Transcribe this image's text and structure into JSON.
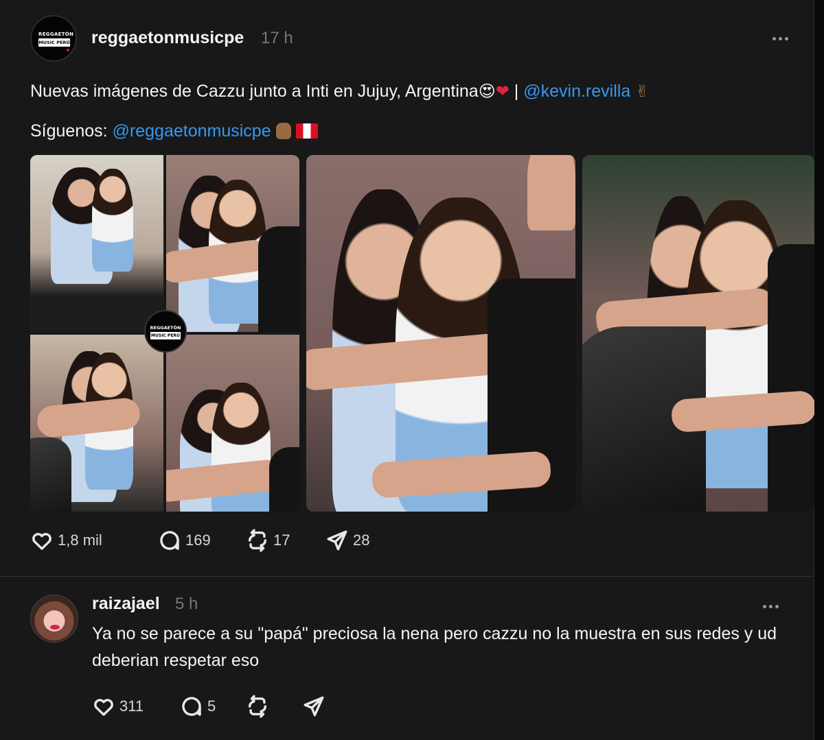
{
  "post": {
    "avatar_logo": {
      "line1": "REGGAETÓN",
      "line2": "MUSIC PERÚ"
    },
    "username": "reggaetonmusicpe",
    "time": "17 h",
    "caption": {
      "text": "Nuevas imágenes de Cazzu junto a Inti en Jujuy, Argentina",
      "emoji_face": "😍",
      "emoji_heart": "❤",
      "separator": " | ",
      "mention": "@kevin.revilla",
      "emoji_peace": "✌"
    },
    "follow": {
      "label": "Síguenos: ",
      "mention": "@reggaetonmusicpe"
    },
    "stats": {
      "likes": "1,8 mil",
      "replies": "169",
      "reposts": "17",
      "shares": "28"
    }
  },
  "reply": {
    "username": "raizajael",
    "time": "5 h",
    "text": "Ya no se parece a su \"papá\" preciosa la nena pero cazzu no la muestra en sus redes y ud deberian respetar eso",
    "stats": {
      "likes": "311",
      "replies": "5"
    }
  },
  "icons": {
    "more": "more-horizontal-icon",
    "like": "heart-icon",
    "reply": "comment-icon",
    "repost": "repost-icon",
    "share": "send-icon"
  },
  "colors": {
    "background": "#181818",
    "text": "#f3f5f7",
    "muted": "#777777",
    "mention": "#3897f0"
  }
}
